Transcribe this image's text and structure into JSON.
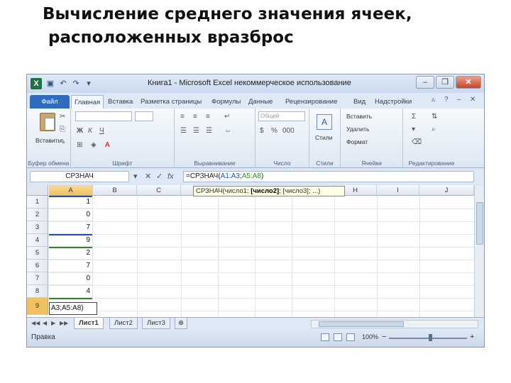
{
  "slide": {
    "title_line1": "Вычисление среднего значения ячеек,",
    "title_line2": " расположенных вразброс"
  },
  "window": {
    "title": "Книга1 - Microsoft Excel некоммерческое использование",
    "minimize": "–",
    "restore": "❐",
    "close": "✕"
  },
  "ribbon": {
    "tabs": [
      "Файл",
      "Главная",
      "Вставка",
      "Разметка страницы",
      "Формулы",
      "Данные",
      "Рецензирование",
      "Вид",
      "Надстройки"
    ],
    "active_tab": "Главная",
    "groups": {
      "clipboard": "Буфер обмена",
      "font": "Шрифт",
      "alignment": "Выравнивание",
      "number": "Число",
      "styles": "Стили",
      "cells": "Ячейки",
      "editing": "Редактирование"
    },
    "paste_label": "Вставить",
    "styles_label": "Стили",
    "number_format": "Общий",
    "cells_buttons": [
      "Вставить",
      "Удалить",
      "Формат"
    ]
  },
  "formula_bar": {
    "name_box": "СРЗНАЧ",
    "formula_prefix": "=СРЗНАЧ(",
    "ref1": "A1:A3",
    "separator": ";",
    "ref2": "A5:A8",
    "formula_suffix": ")"
  },
  "sheet": {
    "columns": [
      "A",
      "B",
      "C",
      "D",
      "E",
      "F",
      "G",
      "H",
      "I",
      "J"
    ],
    "rows": [
      "1",
      "2",
      "3",
      "4",
      "5",
      "6",
      "7",
      "8",
      "9"
    ],
    "values": [
      "1",
      "0",
      "7",
      "9",
      "2",
      "7",
      "0",
      "4"
    ],
    "edit_cell": "A3;A5:A8)",
    "tooltip_prefix": "СРЗНАЧ(число1; ",
    "tooltip_bold": "[число2]",
    "tooltip_suffix": "; [число3]; ...)"
  },
  "sheet_tabs": [
    "Лист1",
    "Лист2",
    "Лист3"
  ],
  "status": {
    "mode": "Правка",
    "zoom": "100%"
  }
}
